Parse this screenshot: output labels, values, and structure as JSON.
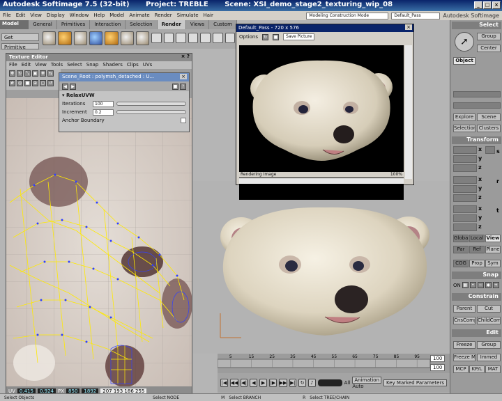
{
  "app": {
    "title": "Autodesk Softimage 7.5 (32-bit)",
    "project": "Project: TREBLE",
    "scene": "Scene: XSI_demo_stage2_texturing_wip_08"
  },
  "menu": [
    "File",
    "Edit",
    "View",
    "Display",
    "Window",
    "Help",
    "Model",
    "Animate",
    "Render",
    "Simulate",
    "Hair"
  ],
  "top_combos": {
    "mode": "Modeling Construction Mode",
    "pass": "Default_Pass"
  },
  "brand": "Autodesk Softimage",
  "module": "Model",
  "module_tabs": [
    "General",
    "Primitives",
    "Interaction",
    "Selection",
    "Render",
    "Views",
    "Custom"
  ],
  "active_tab": "Render",
  "left_buttons": {
    "get": "Get",
    "primitive": "Primitive"
  },
  "texture_editor": {
    "title": "Texture Editor",
    "menu": [
      "File",
      "Edit",
      "View",
      "Tools",
      "Select",
      "Snap",
      "Shaders",
      "Clips",
      "UVs"
    ],
    "status": {
      "uv_label": "UV",
      "u": "0.415",
      "v": "0.924",
      "px_label": "PX",
      "x": "850",
      "y": "1892",
      "rgba": "207  193  186  255"
    }
  },
  "relax_panel": {
    "title": "Scene_Root : polymsh_detached : U...",
    "section": "RelaxUVW",
    "iterations_label": "Iterations",
    "iterations_value": "100",
    "increment_label": "Increment",
    "increment_value": "0.2",
    "anchor_label": "Anchor Boundary"
  },
  "render_window": {
    "title": "Default_Pass - 720 x 576",
    "options": "Options",
    "save": "Save Picture",
    "status_left": "Rendering Image",
    "status_right": "100%"
  },
  "right_panel": {
    "select": "Select",
    "group": "Group",
    "center": "Center",
    "object": "Object",
    "explore": "Explore",
    "scene": "Scene",
    "selection": "Selection",
    "clusters": "Clusters",
    "transform": "Transform",
    "global": "Global",
    "local": "Local",
    "view": "View",
    "par": "Par",
    "ref": "Ref",
    "plane": "Plane",
    "cog": "COG",
    "prop": "Prop",
    "sym": "Sym",
    "snap": "Snap",
    "on": "ON",
    "constrain": "Constrain",
    "parent": "Parent",
    "cut": "Cut",
    "cnscomp": "CnsComp",
    "childcomp": "ChildComp",
    "edit": "Edit",
    "freeze": "Freeze",
    "group2": "Group",
    "freeze_m": "Freeze M",
    "immed": "Immed",
    "mcp": "MCP",
    "kpl": "KP/L",
    "mat": "MAT",
    "s_label": "s",
    "r_label": "r",
    "t_label": "t",
    "x": "x",
    "y": "y",
    "z": "z"
  },
  "timeline": {
    "ticks": [
      "5",
      "15",
      "25",
      "35",
      "45",
      "55",
      "65",
      "75",
      "85",
      "95"
    ],
    "end": "100",
    "start": "1"
  },
  "playback": {
    "frame_label": "All",
    "animation": "Animation",
    "auto": "Auto",
    "key_marked": "Key Marked Parameters"
  },
  "bottom": {
    "select_objects": "Select Objects",
    "select_node": "Select NODE",
    "m": "M",
    "select_branch": "Select BRANCH",
    "r": "R",
    "select_tree": "Select TREE/CHAIN"
  },
  "colors": {
    "title_blue": "#0a246a",
    "uv_line": "#ffea00",
    "uv_vertex": "#3040ff"
  }
}
